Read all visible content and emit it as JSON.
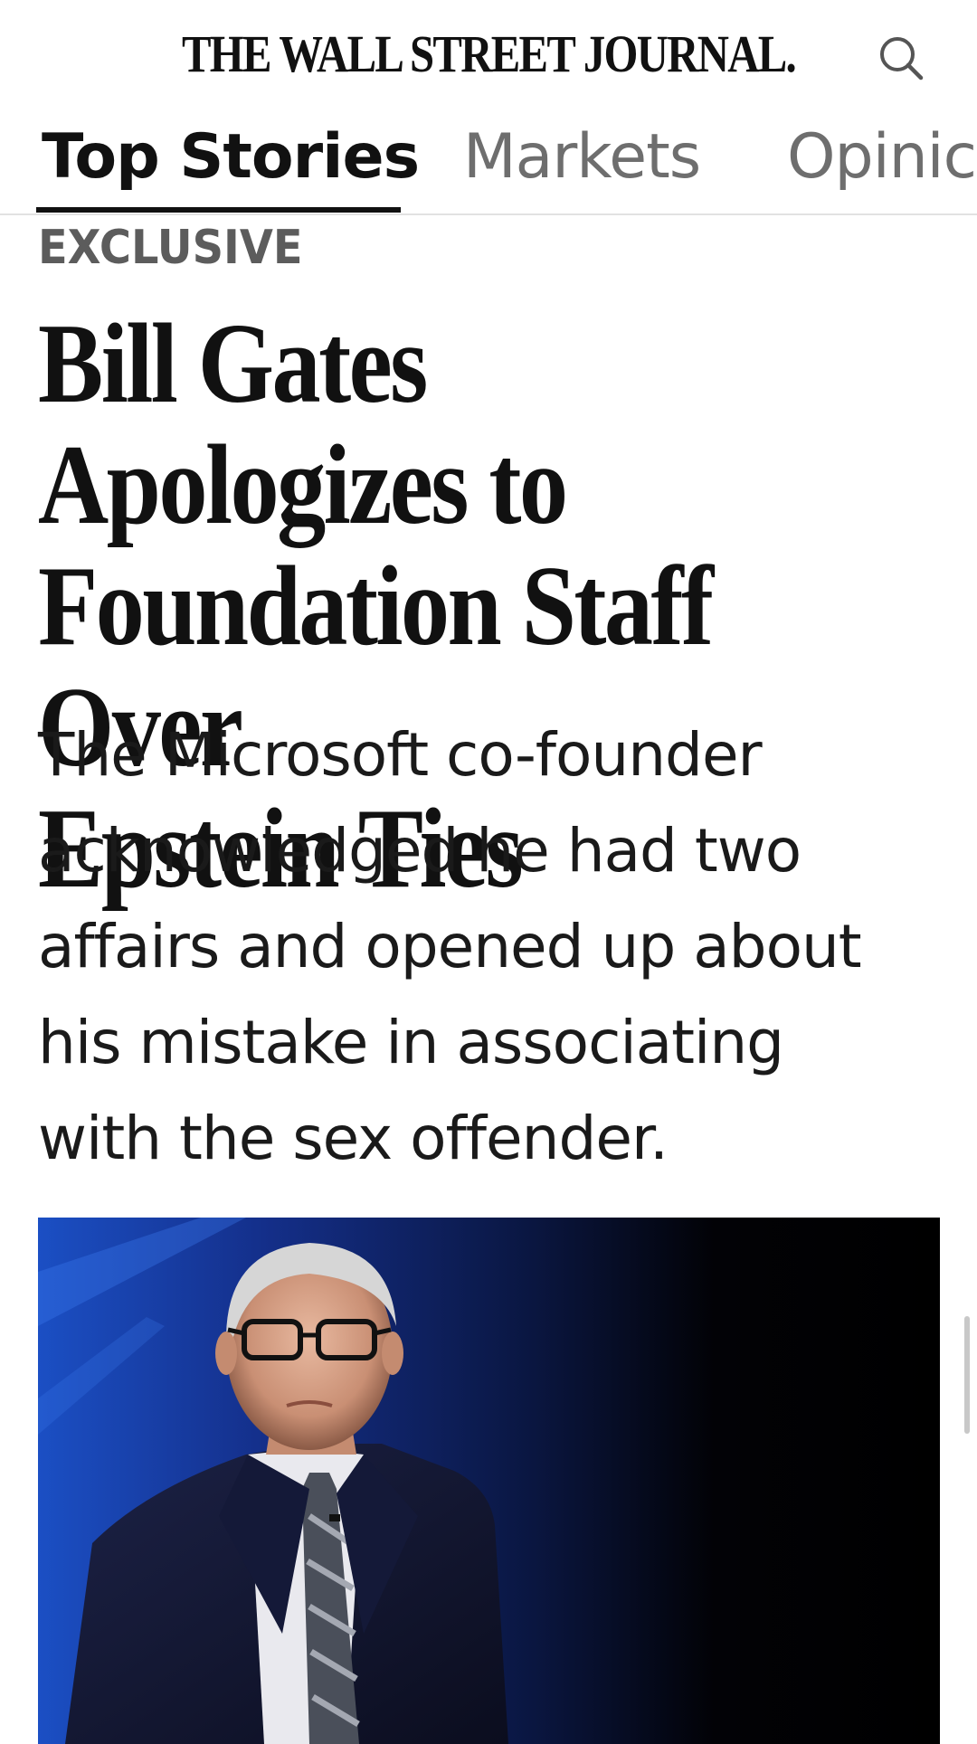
{
  "header": {
    "masthead": "THE WALL STREET JOURNAL.",
    "search_icon": "search-icon"
  },
  "tabs": [
    {
      "label": "Top Stories",
      "active": true
    },
    {
      "label": "Markets",
      "active": false
    },
    {
      "label": "Opinic",
      "active": false
    }
  ],
  "article": {
    "kicker": "EXCLUSIVE",
    "headline_lines": [
      "Bill Gates Apologizes to",
      "Foundation Staff Over",
      "Epstein Ties"
    ],
    "summary_lines": [
      "The Microsoft co-founder",
      "acknowledged he had two",
      "affairs and opened up about",
      "his mistake in associating",
      "with the sex offender."
    ]
  },
  "colors": {
    "text": "#111111",
    "tab_inactive": "#6e6e6e",
    "kicker": "#5c5c5c",
    "divider": "#e2e2e2"
  }
}
